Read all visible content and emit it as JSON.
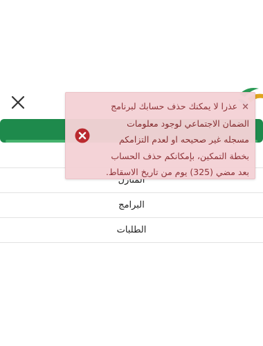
{
  "header": {
    "close_icon": "close-icon",
    "logo_icon": "brand-logo",
    "accent_color": "#1e8a4c"
  },
  "menu": {
    "items": [
      {
        "label": "المنازل"
      },
      {
        "label": "البرامج"
      },
      {
        "label": "الطلبات"
      }
    ]
  },
  "toast": {
    "type": "error",
    "dismiss_symbol": "×",
    "icon": "error-circle-icon",
    "message": "عذرا لا يمكنك حذف حسابك لبرنامج الضمان الاجتماعي لوجود معلومات مسجله غير صحيحه او لعدم التزامكم بخطة التمكين، بإمكانكم حذف الحساب بعد مضي (325) يوم من تاريخ الاسقاط.",
    "background": "#f4d2d6",
    "text_color": "#8a2a2f",
    "icon_color": "#c0262d"
  }
}
